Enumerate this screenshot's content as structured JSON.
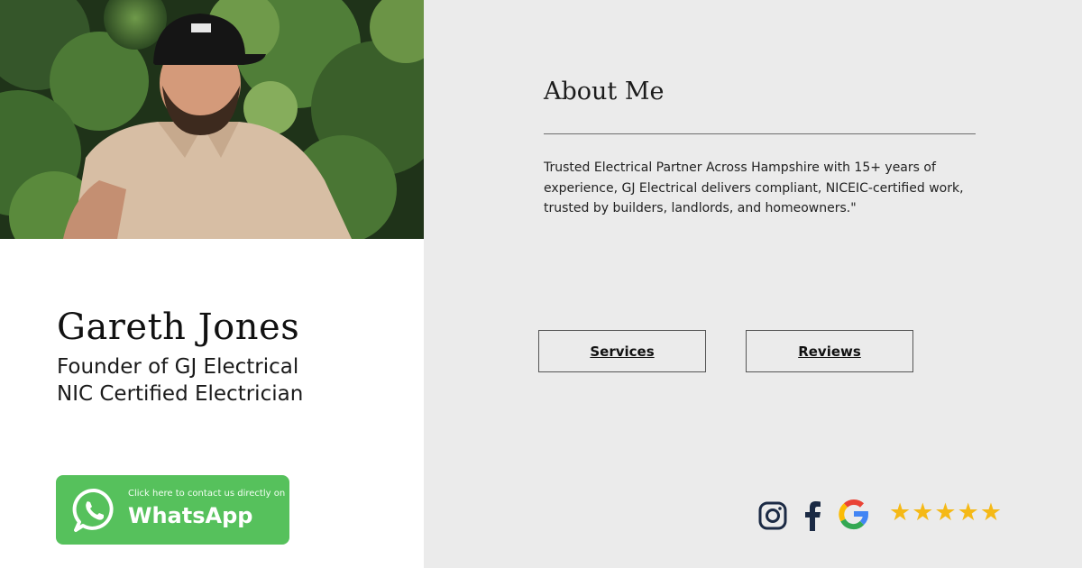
{
  "profile": {
    "name": "Gareth Jones",
    "role_line_1": "Founder of GJ Electrical",
    "role_line_2": "NIC Certified Electrician"
  },
  "whatsapp": {
    "small_text": "Click here to contact us directly on",
    "big_text": "WhatsApp",
    "color": "#56c15c"
  },
  "about": {
    "title": "About Me",
    "body": "Trusted Electrical Partner Across Hampshire with 15+ years of experience, GJ Electrical delivers compliant, NICEIC-certified work, trusted by builders, landlords, and homeowners.\""
  },
  "buttons": {
    "services": "Services",
    "reviews": "Reviews"
  },
  "social": {
    "icons": [
      "instagram-icon",
      "facebook-icon",
      "google-icon"
    ],
    "rating_stars": "★★★★★",
    "rating_value": 5,
    "star_color": "#f5b916"
  },
  "colors": {
    "panel_background": "#ebebeb",
    "left_background": "#ffffff"
  }
}
